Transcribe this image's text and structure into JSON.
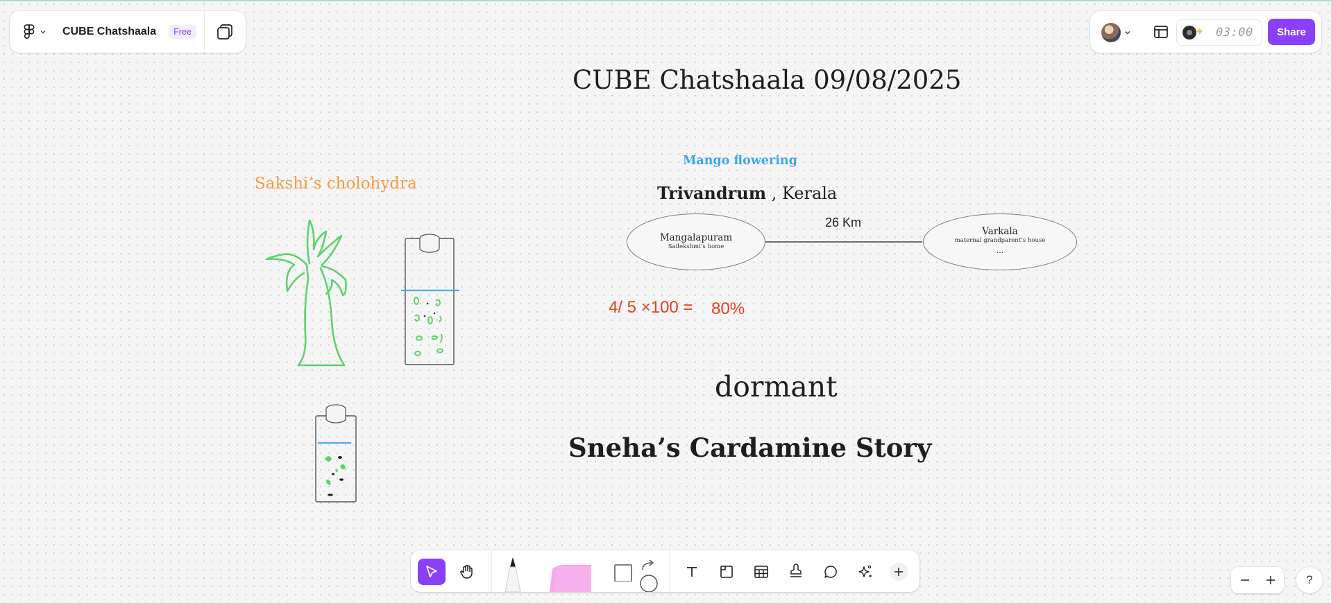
{
  "header": {
    "file_title": "CUBE Chatshaala",
    "plan_badge": "Free",
    "timer": "03:00",
    "share_label": "Share"
  },
  "canvas": {
    "board_title": "CUBE Chatshaala 09/08/2025",
    "mango_heading": "Mango flowering",
    "place_bold": "Trivandrum",
    "place_rest": " , Kerala",
    "sakshi_label": "Sakshi’s cholohydra",
    "calc_expression": "4/ 5 ×100 =",
    "calc_result": "80%",
    "distance_label": "26 Km",
    "node_a": {
      "title": "Mangalapuram",
      "subtitle": "Sailekshmi’s home"
    },
    "node_b": {
      "title": "Varkala",
      "subtitle": "maternal grandparent’s house",
      "more": "..."
    },
    "dormant_text": "dormant",
    "sneha_title": "Sneha’s Cardamine Story"
  },
  "colors": {
    "accent": "#8a3ffc",
    "mango_blue": "#3fa6ec",
    "sakshi_orange": "#f59a46",
    "calc_red": "#e4401f",
    "drawing_green": "#5fd16f",
    "water_line": "#4aa8f0",
    "sticky_pink": "#f7a8e8"
  },
  "toolbar": {
    "tools": [
      "move-tool",
      "hand-tool",
      "marker-tool",
      "sticky-note-tool",
      "shape-tool",
      "connector-tool",
      "text-tool",
      "section-tool",
      "table-tool",
      "stamp-tool",
      "comment-tool",
      "ai-tool",
      "more-tools"
    ]
  },
  "zoom": {
    "out": "−",
    "in": "+",
    "help": "?"
  }
}
